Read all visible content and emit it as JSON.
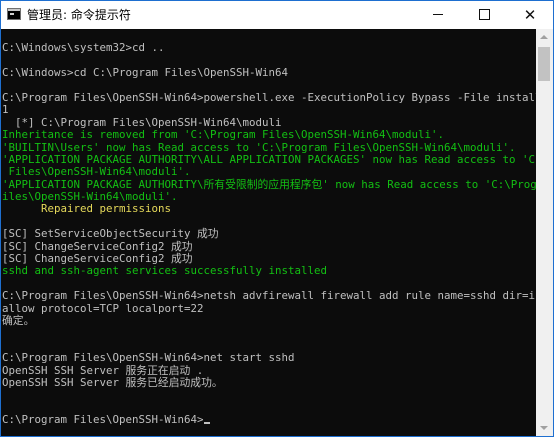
{
  "window": {
    "title": "管理员: 命令提示符",
    "icon": "cmd-icon",
    "minimize_label": "",
    "maximize_label": "",
    "close_label": "✕"
  },
  "colors": {
    "console_background": "#0c0c0c",
    "text_default": "#c0c0c0",
    "text_green": "#13c013",
    "text_yellow": "#e5d95a"
  },
  "console": {
    "lines": [
      {
        "text": "",
        "color": "gray"
      },
      {
        "text": "C:\\Windows\\system32>cd ..",
        "color": "gray"
      },
      {
        "text": "",
        "color": "gray"
      },
      {
        "text": "C:\\Windows>cd C:\\Program Files\\OpenSSH-Win64",
        "color": "gray"
      },
      {
        "text": "",
        "color": "gray"
      },
      {
        "text": "C:\\Program Files\\OpenSSH-Win64>powershell.exe -ExecutionPolicy Bypass -File install-sshd.ps",
        "color": "gray"
      },
      {
        "text": "1",
        "color": "gray"
      },
      {
        "text": "  [*] C:\\Program Files\\OpenSSH-Win64\\moduli",
        "color": "gray"
      },
      {
        "text": "Inheritance is removed from 'C:\\Program Files\\OpenSSH-Win64\\moduli'.",
        "color": "green"
      },
      {
        "text": "'BUILTIN\\Users' now has Read access to 'C:\\Program Files\\OpenSSH-Win64\\moduli'.",
        "color": "green"
      },
      {
        "text": "'APPLICATION PACKAGE AUTHORITY\\ALL APPLICATION PACKAGES' now has Read access to 'C:\\Program",
        "color": "green"
      },
      {
        "text": " Files\\OpenSSH-Win64\\moduli'.",
        "color": "green"
      },
      {
        "text": "'APPLICATION PACKAGE AUTHORITY\\所有受限制的应用程序包' now has Read access to 'C:\\Program F",
        "color": "green"
      },
      {
        "text": "iles\\OpenSSH-Win64\\moduli'.",
        "color": "green"
      },
      {
        "text": "      Repaired permissions",
        "color": "yellow"
      },
      {
        "text": "",
        "color": "gray"
      },
      {
        "text": "[SC] SetServiceObjectSecurity 成功",
        "color": "gray"
      },
      {
        "text": "[SC] ChangeServiceConfig2 成功",
        "color": "gray"
      },
      {
        "text": "[SC] ChangeServiceConfig2 成功",
        "color": "gray"
      },
      {
        "text": "sshd and ssh-agent services successfully installed",
        "color": "green"
      },
      {
        "text": "",
        "color": "gray"
      },
      {
        "text": "C:\\Program Files\\OpenSSH-Win64>netsh advfirewall firewall add rule name=sshd dir=in action=",
        "color": "gray"
      },
      {
        "text": "allow protocol=TCP localport=22",
        "color": "gray"
      },
      {
        "text": "确定。",
        "color": "gray"
      },
      {
        "text": "",
        "color": "gray"
      },
      {
        "text": "",
        "color": "gray"
      },
      {
        "text": "C:\\Program Files\\OpenSSH-Win64>net start sshd",
        "color": "gray"
      },
      {
        "text": "OpenSSH SSH Server 服务正在启动 .",
        "color": "gray"
      },
      {
        "text": "OpenSSH SSH Server 服务已经启动成功。",
        "color": "gray"
      },
      {
        "text": "",
        "color": "gray"
      },
      {
        "text": "",
        "color": "gray"
      },
      {
        "text": "C:\\Program Files\\OpenSSH-Win64>",
        "color": "gray",
        "cursor": true
      }
    ]
  }
}
